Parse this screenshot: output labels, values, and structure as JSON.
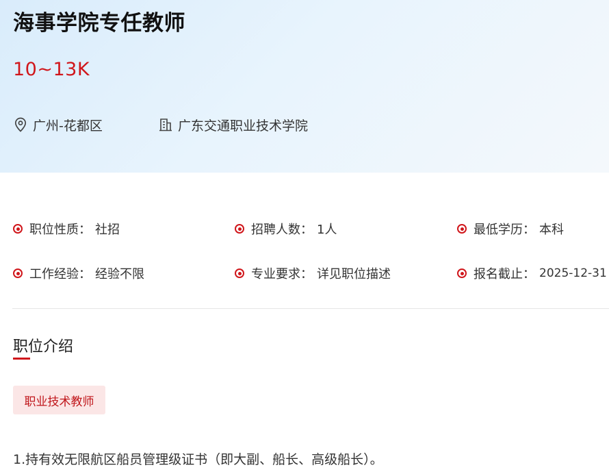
{
  "job": {
    "title": "海事学院专任教师",
    "salary": "10~13K",
    "location": "广州-花都区",
    "organization": "广东交通职业技术学院"
  },
  "attributes": [
    {
      "label": "职位性质：",
      "value": "社招"
    },
    {
      "label": "招聘人数：",
      "value": "1人"
    },
    {
      "label": "最低学历：",
      "value": "本科"
    },
    {
      "label": "工作经验：",
      "value": "经验不限"
    },
    {
      "label": "专业要求：",
      "value": "详见职位描述"
    },
    {
      "label": "报名截止：",
      "value": "2025-12-31"
    }
  ],
  "description": {
    "section_title": "职位介绍",
    "tag": "职业技术教师",
    "lines": [
      "1.持有效无限航区船员管理级证书（即大副、船长、高级船长）。"
    ]
  },
  "icons": {
    "location": "location-pin-icon",
    "organization": "building-icon",
    "bullet": "radio-dot-icon"
  },
  "colors": {
    "accent": "#d0161b",
    "tag_bg": "#fbe6e6",
    "hero_bg": "#e3f1fc"
  }
}
